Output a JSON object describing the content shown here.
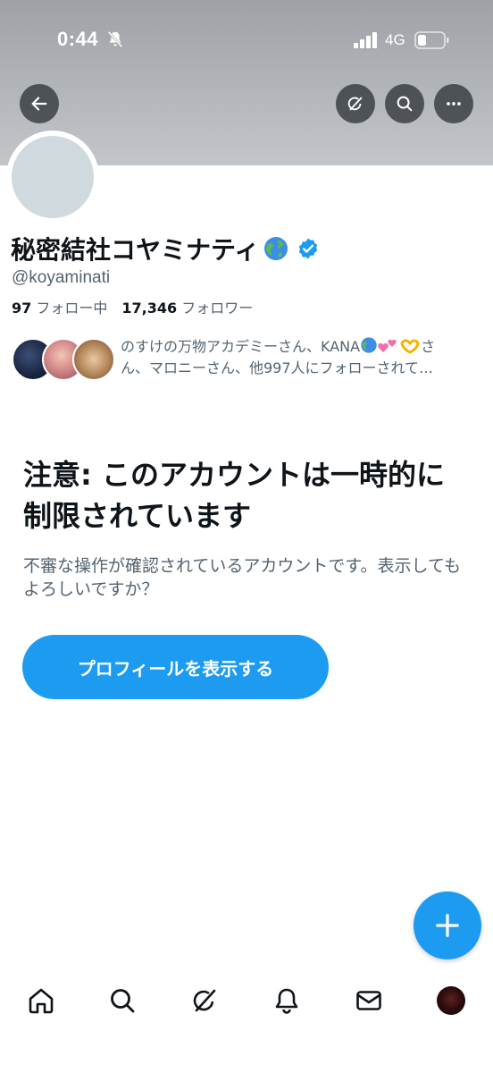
{
  "status_bar": {
    "time": "0:44",
    "network": "4G"
  },
  "header": {
    "back_icon": "arrow-left-icon",
    "grok_icon": "grok-icon",
    "search_icon": "search-icon",
    "more_icon": "more-icon"
  },
  "profile": {
    "display_name": "秘密結社コヤミナティ",
    "handle": "@koyaminati",
    "following_count": "97",
    "following_label": "フォロー中",
    "followers_count": "17,346",
    "followers_label": "フォロワー",
    "followers_you_know_line1": "のすけの万物アカデミーさん、KANA",
    "followers_you_know_line1_tail": "さ",
    "followers_you_know_line2": "ん、マロニーさん、他997人にフォローされて…"
  },
  "warning": {
    "title": "注意: このアカウントは一時的に制限されています",
    "description": "不審な操作が確認されているアカウントです。表示してもよろしいですか？",
    "button_label": "プロフィールを表示する"
  },
  "colors": {
    "accent": "#1d9bf0",
    "text_primary": "#0f1419",
    "text_secondary": "#536471"
  },
  "bottom_nav": [
    "home-icon",
    "search-icon",
    "grok-icon",
    "notifications-icon",
    "messages-icon",
    "profile-avatar"
  ]
}
